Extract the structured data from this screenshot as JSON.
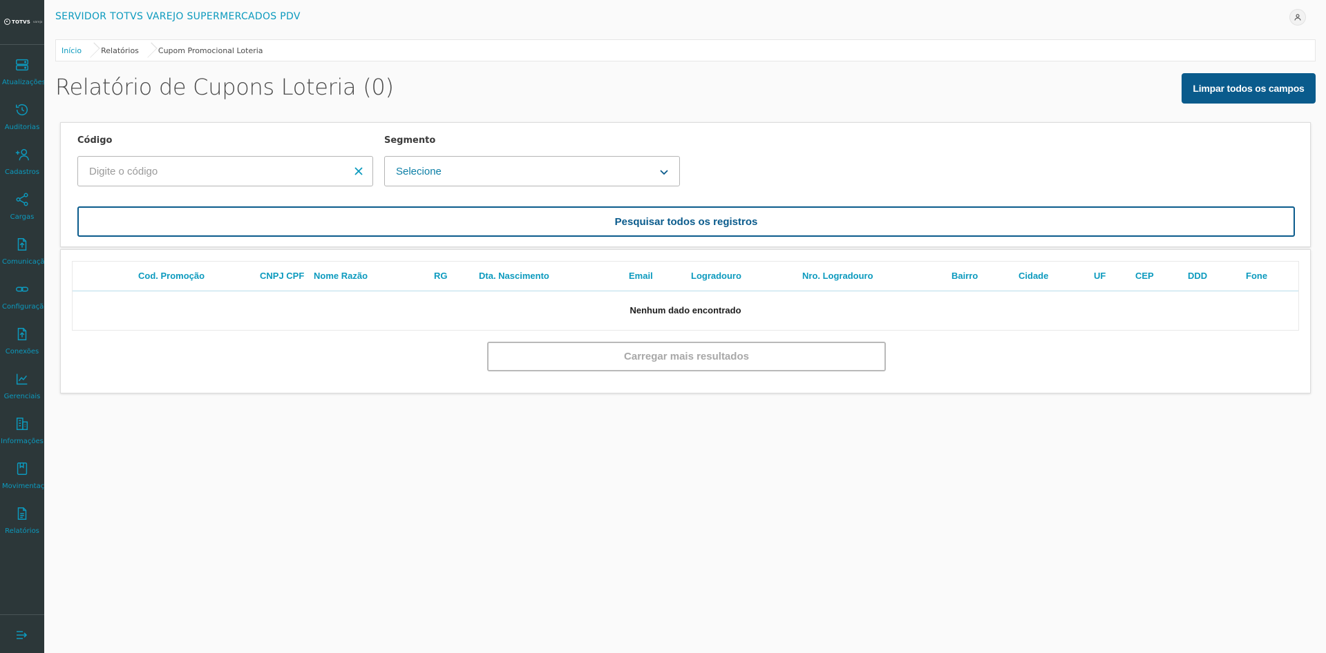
{
  "app": {
    "title": "SERVIDOR TOTVS VAREJO SUPERMERCADOS PDV",
    "logo_text": "TOTVS",
    "logo_sub": "varejo"
  },
  "sidebar": {
    "items": [
      {
        "label": "Atualizações",
        "icon": "server-icon"
      },
      {
        "label": "Auditorias",
        "icon": "history-icon"
      },
      {
        "label": "Cadastros",
        "icon": "add-user-icon"
      },
      {
        "label": "Cargas",
        "icon": "share-icon"
      },
      {
        "label": "Comunicação",
        "icon": "file-upload-icon"
      },
      {
        "label": "Configuração",
        "icon": "link-icon"
      },
      {
        "label": "Conexões",
        "icon": "file-upload-icon"
      },
      {
        "label": "Gerenciais",
        "icon": "chart-icon"
      },
      {
        "label": "Informações",
        "icon": "building-icon"
      },
      {
        "label": "Movimentação",
        "icon": "book-icon"
      },
      {
        "label": "Relatórios",
        "icon": "document-icon"
      }
    ]
  },
  "breadcrumb": {
    "items": [
      "Início",
      "Relatórios",
      "Cupom Promocional Loteria"
    ]
  },
  "page": {
    "title": "Relatório de Cupons Loteria (0)",
    "clear_all_label": "Limpar todos os campos"
  },
  "filters": {
    "codigo": {
      "label": "Código",
      "placeholder": "Digite o código",
      "value": ""
    },
    "segmento": {
      "label": "Segmento",
      "selected": "Selecione"
    },
    "search_all_label": "Pesquisar todos os registros"
  },
  "table": {
    "columns": [
      "Cod. Promoção",
      "CNPJ CPF",
      "Nome Razão",
      "RG",
      "Dta. Nascimento",
      "Email",
      "Logradouro",
      "Nro. Logradouro",
      "Bairro",
      "Cidade",
      "UF",
      "CEP",
      "DDD",
      "Fone"
    ],
    "rows": [],
    "empty_message": "Nenhum dado encontrado"
  },
  "load_more_label": "Carregar mais resultados",
  "colors": {
    "sidebar_bg": "#2c3739",
    "accent": "#0c9abe",
    "primary": "#0a5b8c"
  }
}
